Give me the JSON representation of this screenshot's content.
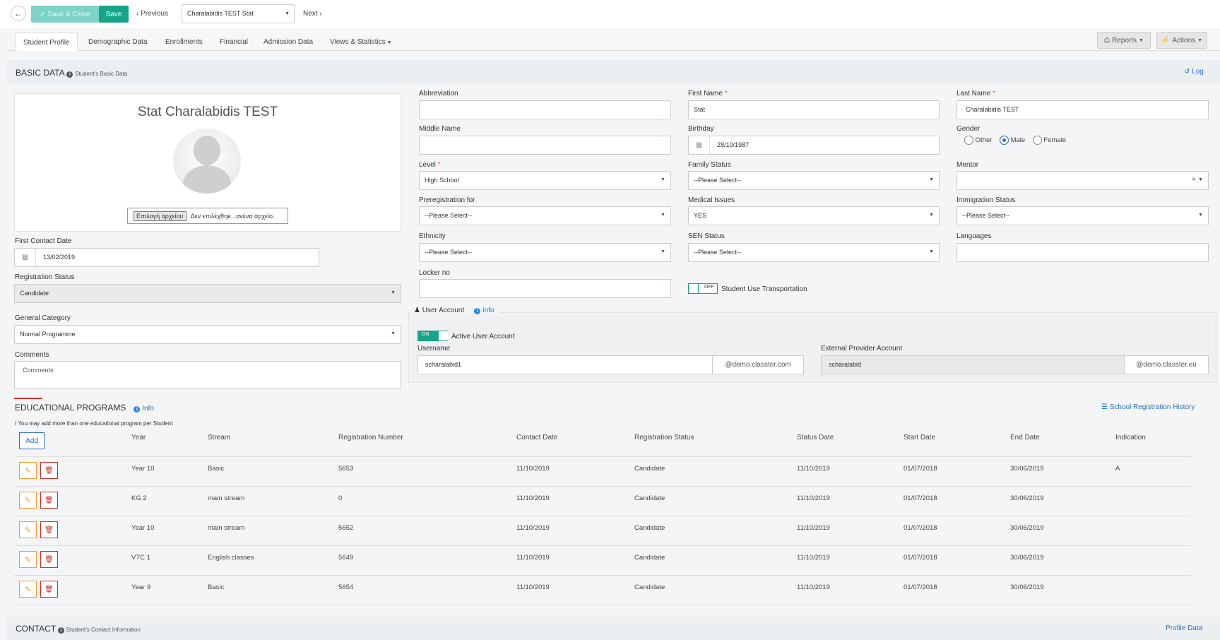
{
  "toolbar": {
    "back_icon": "arrow-left-icon",
    "save_close_label": "Save & Close",
    "save_label": "Save",
    "previous_label": "Previous",
    "next_label": "Next",
    "student_selector_value": "Charalabidis TEST Stat"
  },
  "tabs": [
    "Student Profile",
    "Demographic Data",
    "Enrollments",
    "Financial",
    "Admission Data",
    "Views & Statistics"
  ],
  "header_actions": {
    "reports_label": "Reports",
    "actions_label": "Actions"
  },
  "basic_data": {
    "title": "BASIC DATA",
    "subtitle": "Student's Basic Data",
    "log_label": "Log",
    "student_name": "Stat Charalabidis TEST",
    "file_button": "Επιλογή αρχείου",
    "file_status": "Δεν επιλέχθηκ...ανένα αρχείο.",
    "first_contact_date_label": "First Contact Date",
    "first_contact_date": "13/02/2019",
    "registration_status_label": "Registration Status",
    "registration_status": "Candidate",
    "general_category_label": "General Category",
    "general_category": "Normal Programme",
    "comments_label": "Comments",
    "comments_placeholder": "Comments"
  },
  "fields": {
    "abbreviation_label": "Abbreviation",
    "abbreviation": "",
    "first_name_label": "First Name",
    "first_name": "Stat",
    "last_name_label": "Last Name",
    "last_name": "Charalabidis TEST",
    "middle_name_label": "Middle Name",
    "middle_name": "",
    "birthday_label": "Birthday",
    "birthday": "28/10/1987",
    "gender_label": "Gender",
    "gender_options": [
      "Other",
      "Male",
      "Female"
    ],
    "gender_selected": "Male",
    "level_label": "Level",
    "level": "High School",
    "family_status_label": "Family Status",
    "family_status": "--Please Select--",
    "mentor_label": "Mentor",
    "mentor": "",
    "preregistration_label": "Preregistration for",
    "preregistration": "--Please Select--",
    "medical_issues_label": "Medical Issues",
    "medical_issues": "YES",
    "immigration_status_label": "Immigration Status",
    "immigration_status": "--Please Select--",
    "ethnicity_label": "Ethnicity",
    "ethnicity": "--Please Select--",
    "sen_status_label": "SEN Status",
    "sen_status": "--Please Select--",
    "languages_label": "Languages",
    "languages": "",
    "locker_label": "Locker no",
    "locker": "",
    "transport_toggle": "OFF",
    "transport_label": "Student Use Transportation"
  },
  "user_account": {
    "title": "User Account",
    "info_label": "Info",
    "active_toggle": "ON",
    "active_label": "Active User Account",
    "username_label": "Username",
    "username": "scharalabid1",
    "username_domain": "@demo.classter.com",
    "external_label": "External Provider Account",
    "external": "scharalabid",
    "external_domain": "@demo.classter.eu"
  },
  "educational_programs": {
    "title": "EDUCATIONAL PROGRAMS",
    "info_label": "Info",
    "history_label": "School Registration History",
    "note": "You may add more than one educational program per Student",
    "add_label": "Add",
    "columns": [
      "Year",
      "Stream",
      "Registration Number",
      "Contact Date",
      "Registration Status",
      "Status Date",
      "Start Date",
      "End Date",
      "Indication"
    ],
    "rows": [
      [
        "Year 10",
        "Basic",
        "5653",
        "11/10/2019",
        "Candidate",
        "11/10/2019",
        "01/07/2018",
        "30/06/2019",
        "A"
      ],
      [
        "KG 2",
        "main stream",
        "0",
        "11/10/2019",
        "Candidate",
        "11/10/2019",
        "01/07/2018",
        "30/06/2019",
        ""
      ],
      [
        "Year 10",
        "main stream",
        "5652",
        "11/10/2019",
        "Candidate",
        "11/10/2019",
        "01/07/2018",
        "30/06/2019",
        ""
      ],
      [
        "VTC 1",
        "English classes",
        "5649",
        "11/10/2019",
        "Candidate",
        "11/10/2019",
        "01/07/2018",
        "30/06/2019",
        ""
      ],
      [
        "Year 9",
        "Basic",
        "5654",
        "11/10/2019",
        "Candidate",
        "11/10/2019",
        "01/07/2018",
        "30/06/2019",
        ""
      ]
    ]
  },
  "contact": {
    "title": "CONTACT",
    "subtitle": "Student's Contact Information",
    "profile_data_label": "Profile Data"
  },
  "colors": {
    "primary": "#16a58a",
    "link": "#2e6fbf",
    "danger": "#c9302c",
    "warning": "#f0a030"
  }
}
